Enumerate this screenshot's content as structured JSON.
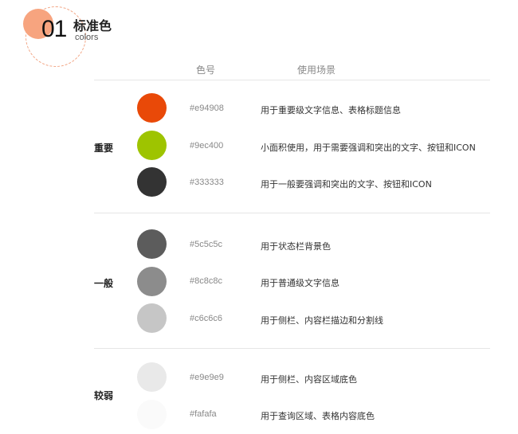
{
  "header": {
    "number": "01",
    "title": "标准色",
    "subtitle": "colors"
  },
  "columns": {
    "code": "色号",
    "usage": "使用场景"
  },
  "groups": [
    {
      "label": "重要",
      "items": [
        {
          "color": "#e94908",
          "code": "#e94908",
          "usage": "用于重要级文字信息、表格标题信息"
        },
        {
          "color": "#9ec400",
          "code": "#9ec400",
          "usage": "小面积使用，用于需要强调和突出的文字、按钮和ICON"
        },
        {
          "color": "#333333",
          "code": "#333333",
          "usage": "用于一般要强调和突出的文字、按钮和ICON"
        }
      ]
    },
    {
      "label": "一般",
      "items": [
        {
          "color": "#5c5c5c",
          "code": "#5c5c5c",
          "usage": "用于状态栏背景色"
        },
        {
          "color": "#8c8c8c",
          "code": "#8c8c8c",
          "usage": "用于普通级文字信息"
        },
        {
          "color": "#c6c6c6",
          "code": "#c6c6c6",
          "usage": "用于侧栏、内容栏描边和分割线"
        }
      ]
    },
    {
      "label": "较弱",
      "items": [
        {
          "color": "#e9e9e9",
          "code": "#e9e9e9",
          "usage": "用于侧栏、内容区域底色"
        },
        {
          "color": "#fafafa",
          "code": "#fafafa",
          "usage": "用于查询区域、表格内容底色"
        }
      ]
    }
  ]
}
